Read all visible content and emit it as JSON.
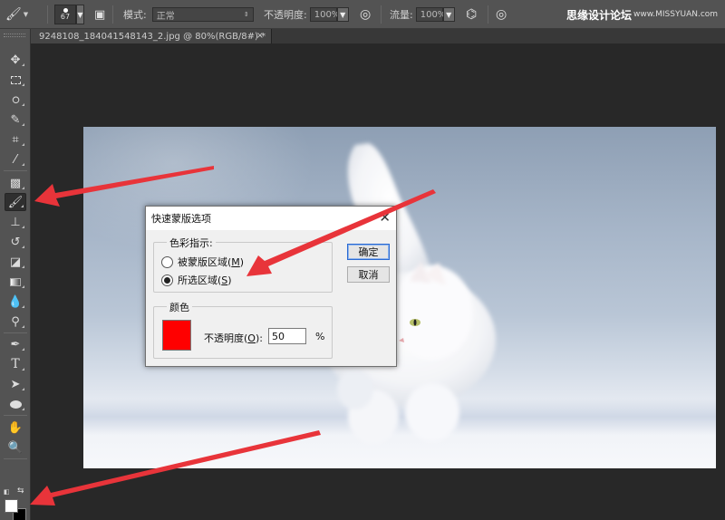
{
  "options_bar": {
    "brush_size": "67",
    "mode_label": "模式:",
    "mode_value": "正常",
    "opacity_label": "不透明度:",
    "opacity_value": "100%",
    "flow_label": "流量:",
    "flow_value": "100%",
    "watermark": "思缘设计论坛",
    "watermark_url": "www.MISSYUAN.com"
  },
  "document_tab": {
    "title": "9248108_184041548143_2.jpg @ 80%(RGB/8#) *",
    "close": "×"
  },
  "dialog": {
    "title": "快速蒙版选项",
    "close": "✕",
    "color_indicates_label": "色彩指示:",
    "option_masked_areas": "被蒙版区域(",
    "option_masked_key": "M",
    "option_selected_areas": "所选区域(",
    "option_selected_key": "S",
    "selected_option": "selected_areas",
    "color_group_label": "颜色",
    "mask_color": "#ff0000",
    "opacity_label": "不透明度(",
    "opacity_key": "O",
    "opacity_value": "50",
    "opacity_unit": "%",
    "ok_button": "确定",
    "cancel_button": "取消"
  },
  "colors": {
    "foreground": "#ffffff",
    "background": "#000000",
    "annotation_arrow": "#e8343a"
  },
  "icons": {
    "brush_tool": "brush-icon",
    "quick_mask": "quick-mask-icon"
  }
}
